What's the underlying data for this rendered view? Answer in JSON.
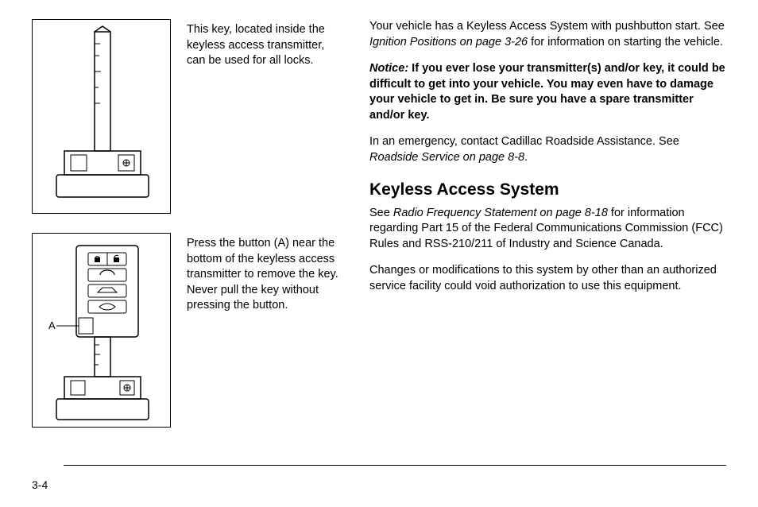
{
  "left": {
    "caption1": "This key, located inside the keyless access transmitter, can be used for all locks.",
    "caption2": "Press the button (A) near the bottom of the keyless access transmitter to remove the key. Never pull the key without pressing the button.",
    "labelA": "A"
  },
  "right": {
    "p1a": "Your vehicle has a Keyless Access System with pushbutton start. See ",
    "p1b": "Ignition Positions on page 3-26",
    "p1c": " for information on starting the vehicle.",
    "noticeLabel": "Notice:",
    "noticeText": " If you ever lose your transmitter(s) and/or key, it could be difficult to get into your vehicle. You may even have to damage your vehicle to get in. Be sure you have a spare transmitter and/or key.",
    "p3a": "In an emergency, contact Cadillac Roadside Assistance. See ",
    "p3b": "Roadside Service on page 8-8",
    "p3c": ".",
    "heading": "Keyless Access System",
    "p4a": "See ",
    "p4b": "Radio Frequency Statement on page 8-18",
    "p4c": " for information regarding Part 15 of the Federal Communications Commission (FCC) Rules and RSS-210/211 of Industry and Science Canada.",
    "p5": "Changes or modifications to this system by other than an authorized service facility could void authorization to use this equipment."
  },
  "pageNumber": "3-4"
}
